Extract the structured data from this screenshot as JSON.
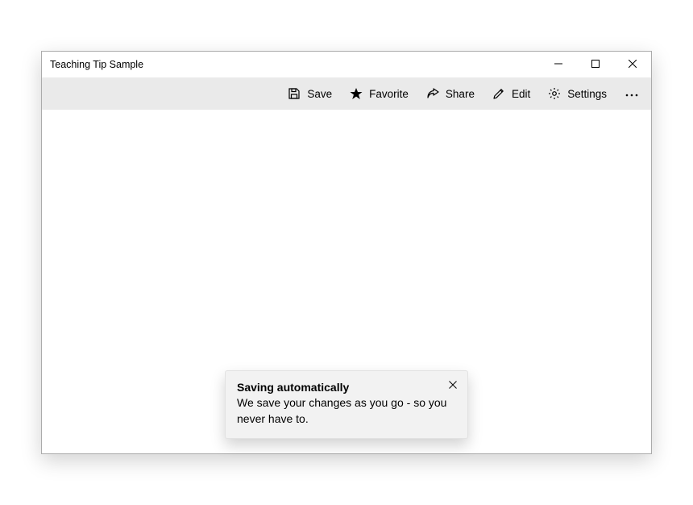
{
  "window": {
    "title": "Teaching Tip Sample"
  },
  "commandbar": {
    "save_label": "Save",
    "favorite_label": "Favorite",
    "share_label": "Share",
    "edit_label": "Edit",
    "settings_label": "Settings"
  },
  "teaching_tip": {
    "title": "Saving automatically",
    "body": "We save your changes as you go - so you never have to."
  }
}
